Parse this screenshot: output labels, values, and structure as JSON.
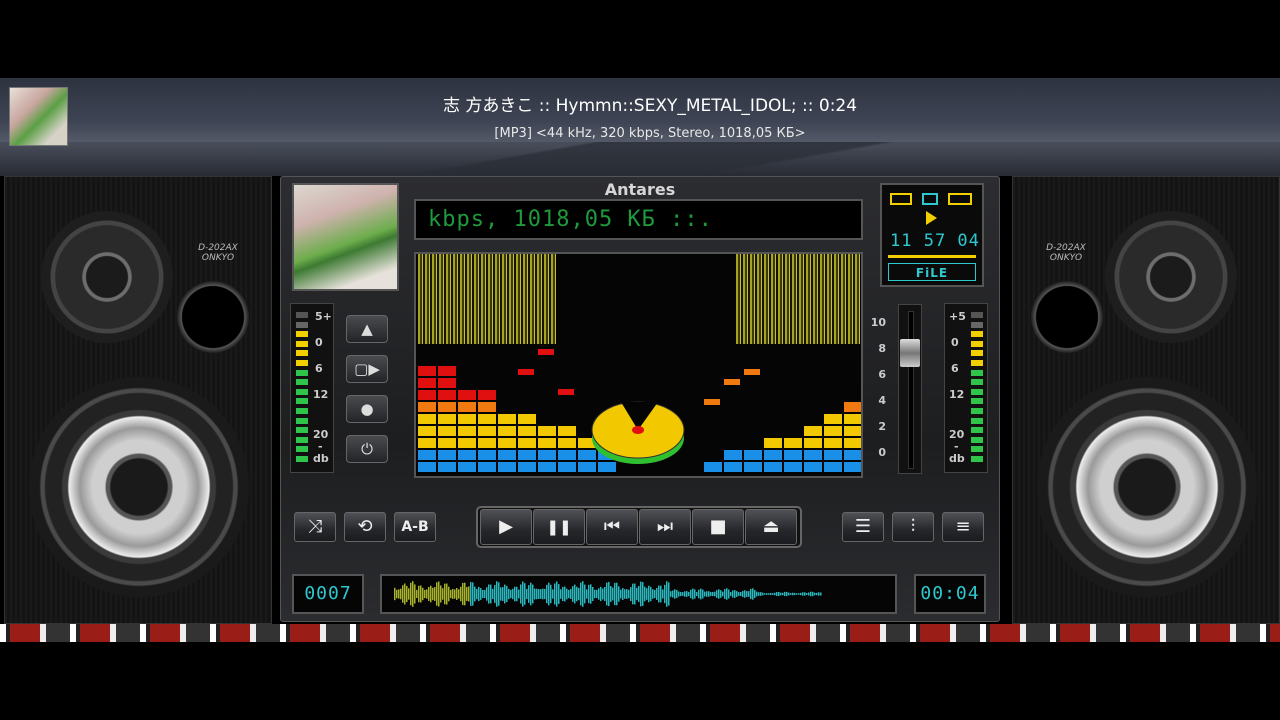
{
  "header": {
    "track_title": "志 方あきこ :: Hymmn::SEXY_METAL_IDOL; :: 0:24",
    "track_info": "[MP3] <44 kHz, 320 kbps, Stereo, 1018,05 КБ>"
  },
  "player": {
    "app_title": "Antares",
    "lcd_scroll_text": "kbps, 1018,05 КБ ::.",
    "clock": "11 57 04",
    "mode_label": "FiLE",
    "track_number": "0007",
    "elapsed": "00:04",
    "playback_progress": 0.17
  },
  "vu_labels": [
    "5+",
    "0",
    "6",
    "12",
    "20",
    "-",
    "db"
  ],
  "vu_labels_right": [
    "+5",
    "0",
    "6",
    "12",
    "20",
    "-",
    "db"
  ],
  "eq_scale": [
    "10",
    "8",
    "6",
    "4",
    "2",
    "0"
  ],
  "side_buttons": {
    "up": "▲",
    "screen": "▢▶",
    "record": "●",
    "power": "⏻"
  },
  "buttons": {
    "shuffle": "⤨",
    "repeat": "⟲",
    "ab_repeat": "A-B",
    "play": "▶",
    "pause": "❚❚",
    "prev": "⏮",
    "next": "⏭",
    "stop": "■",
    "eject": "⏏",
    "playlist": "☰",
    "equalizer": "⫶",
    "menu": "≡"
  },
  "colors": {
    "lcd_green": "#1e9a3c",
    "display_cyan": "#2ec9cf",
    "bar_blue": "#1a8fe8",
    "bar_yellow": "#f2c800",
    "bar_orange": "#f07a10",
    "bar_red": "#e01010"
  }
}
